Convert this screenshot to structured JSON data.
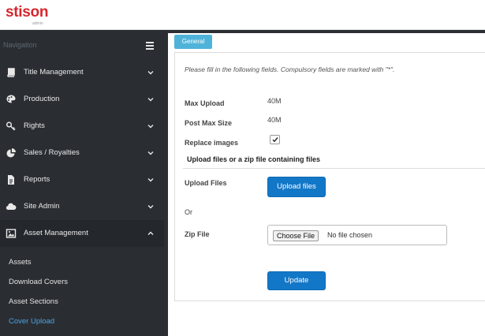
{
  "brand": {
    "logo": "stison",
    "sub": "admin",
    "accent": "#d6262d"
  },
  "sidebar": {
    "title": "Navigation",
    "items": [
      {
        "label": "Title Management",
        "icon": "book-icon",
        "expanded": false
      },
      {
        "label": "Production",
        "icon": "palette-icon",
        "expanded": false
      },
      {
        "label": "Rights",
        "icon": "key-icon",
        "expanded": false
      },
      {
        "label": "Sales / Royalties",
        "icon": "pie-chart-icon",
        "expanded": false
      },
      {
        "label": "Reports",
        "icon": "document-icon",
        "expanded": false
      },
      {
        "label": "Site Admin",
        "icon": "cloud-icon",
        "expanded": false
      },
      {
        "label": "Asset Management",
        "icon": "image-icon",
        "expanded": true
      }
    ],
    "sub_items": [
      {
        "label": "Assets"
      },
      {
        "label": "Download Covers"
      },
      {
        "label": "Asset Sections"
      },
      {
        "label": "Cover Upload",
        "current": true
      }
    ]
  },
  "main": {
    "tab_label": "General",
    "intro": "Please fill in the following fields. Compulsory fields are marked with \"*\".",
    "max_upload_label": "Max Upload",
    "max_upload_value": "40M",
    "post_max_label": "Post Max Size",
    "post_max_value": "40M",
    "replace_label": "Replace images",
    "replace_checked": true,
    "section_title": "Upload files or a zip file containing files",
    "upload_files_label": "Upload Files",
    "upload_files_button": "Upload files",
    "or_text": "Or",
    "zip_label": "Zip File",
    "choose_file_button": "Choose File",
    "no_file_text": "No file chosen",
    "update_button": "Update"
  },
  "colors": {
    "sidebar_bg": "#2a2e33",
    "primary": "#1377c8",
    "tab": "#4fb3d9",
    "active_link": "#4ba3e3"
  }
}
